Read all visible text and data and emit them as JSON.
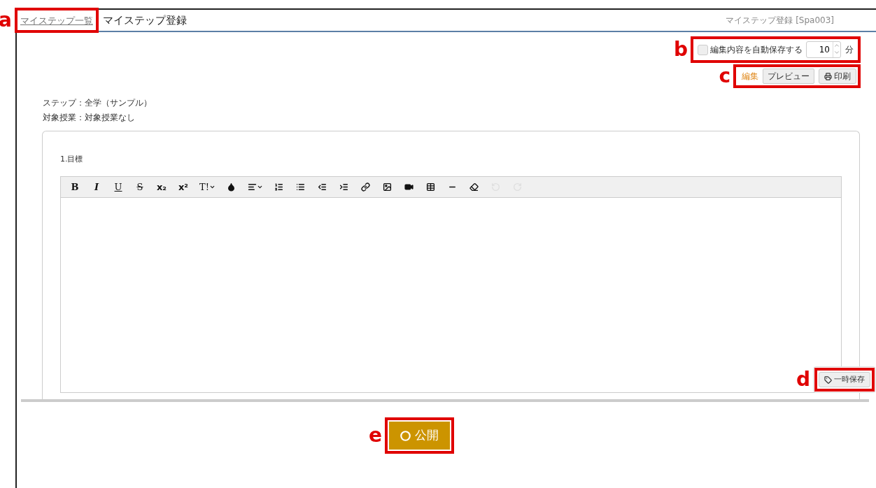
{
  "header": {
    "breadcrumb": [
      {
        "label": "マイステップ一覧",
        "link": true,
        "callout": "a"
      },
      {
        "label": "マイステップ登録",
        "link": false
      }
    ],
    "screen_id": "マイステップ登録 [Spa003]"
  },
  "autosave": {
    "label": "編集内容を自動保存する",
    "checked": false,
    "interval": "10",
    "unit": "分",
    "callout": "b"
  },
  "mode_tabs": [
    {
      "label": "編集",
      "selected": true
    },
    {
      "label": "プレビュー",
      "selected": false
    }
  ],
  "print_button": {
    "label": "印刷"
  },
  "mode_callout": "c",
  "info": [
    "ステップ：全学（サンプル）",
    "対象授業：対象授業なし"
  ],
  "section": {
    "title": "1.目標",
    "toolbar": [
      {
        "kind": "bold",
        "glyph": "B",
        "disabled": false
      },
      {
        "kind": "italic",
        "glyph": "I",
        "disabled": false
      },
      {
        "kind": "underline",
        "glyph": "U",
        "disabled": false
      },
      {
        "kind": "strike",
        "glyph": "S",
        "disabled": false
      },
      {
        "kind": "subscript",
        "glyph": "x₂",
        "disabled": false
      },
      {
        "kind": "superscript",
        "glyph": "x²",
        "disabled": false
      },
      {
        "kind": "fontsize",
        "glyph": "T!",
        "disabled": false
      },
      {
        "kind": "color",
        "disabled": false
      },
      {
        "kind": "align",
        "disabled": false
      },
      {
        "kind": "ordered-list",
        "disabled": false
      },
      {
        "kind": "bullet-list",
        "disabled": false
      },
      {
        "kind": "outdent",
        "disabled": false
      },
      {
        "kind": "indent",
        "disabled": false
      },
      {
        "kind": "link",
        "disabled": false
      },
      {
        "kind": "image",
        "disabled": false
      },
      {
        "kind": "video",
        "disabled": false
      },
      {
        "kind": "table",
        "disabled": false
      },
      {
        "kind": "rule",
        "disabled": false
      },
      {
        "kind": "eraser",
        "disabled": false
      },
      {
        "kind": "undo",
        "disabled": true
      },
      {
        "kind": "redo",
        "disabled": true
      }
    ]
  },
  "temp_save_button": {
    "label": "一時保存",
    "callout": "d"
  },
  "publish_button": {
    "label": "公開",
    "callout": "e"
  }
}
